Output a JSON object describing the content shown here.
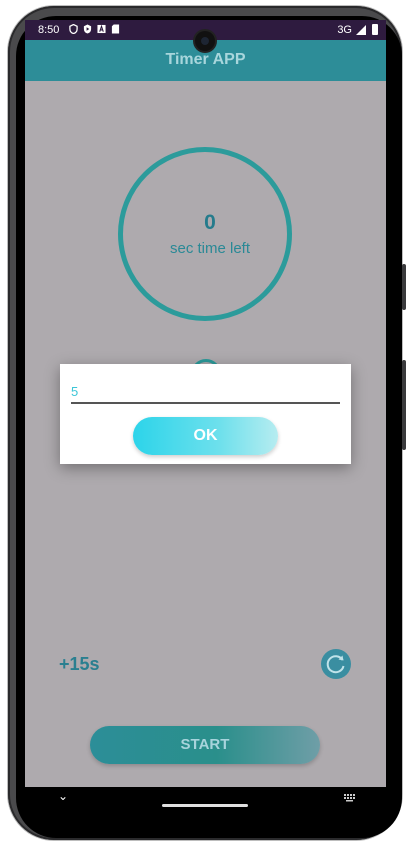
{
  "status_bar": {
    "time": "8:50",
    "network": "3G",
    "icons": [
      "shield-icon",
      "play-protect-icon",
      "font-icon",
      "sd-card-icon"
    ]
  },
  "app_bar": {
    "title": "Timer APP"
  },
  "timer": {
    "value": "0",
    "label": "sec time left"
  },
  "controls": {
    "add_time_label": "+15s",
    "reset_icon": "reset-icon",
    "start_label": "START"
  },
  "dialog": {
    "input_value": "5",
    "ok_label": "OK"
  },
  "colors": {
    "accent": "#2d8d98",
    "dialog_button": "#2cd4ea",
    "scrim_background": "#aeaaae",
    "status_bar": "#2e1b3f"
  }
}
